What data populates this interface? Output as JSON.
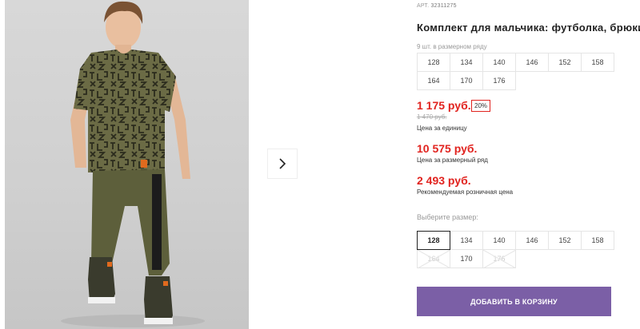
{
  "product": {
    "article_label": "АРТ.",
    "article_value": "32311275",
    "title": "Комплект для мальчика: футболка, брюки"
  },
  "pack": {
    "note": "9 шт. в размерном ряду",
    "sizes": [
      "128",
      "134",
      "140",
      "146",
      "152",
      "158",
      "164",
      "170",
      "176"
    ]
  },
  "prices": {
    "unit_price": "1 175 руб.",
    "discount": "20%",
    "old_price": "1 470 руб.",
    "unit_note": "Цена за единицу",
    "set_price": "10 575 руб.",
    "set_note": "Цена за размерный ряд",
    "rrp_price": "2 493 руб.",
    "rrp_note": "Рекомендуемая розничная цена"
  },
  "size_picker": {
    "label": "Выберите размер:",
    "selected": "128",
    "options": [
      {
        "label": "128",
        "state": "selected"
      },
      {
        "label": "134",
        "state": "available"
      },
      {
        "label": "140",
        "state": "available"
      },
      {
        "label": "146",
        "state": "available"
      },
      {
        "label": "152",
        "state": "available"
      },
      {
        "label": "158",
        "state": "available"
      },
      {
        "label": "164",
        "state": "unavailable"
      },
      {
        "label": "170",
        "state": "available"
      },
      {
        "label": "176",
        "state": "unavailable"
      }
    ]
  },
  "cart": {
    "button_label": "ДОБАВИТЬ В КОРЗИНУ"
  },
  "gallery": {
    "next_icon": "chevron-right-icon"
  },
  "colors": {
    "price_red": "#e1231f",
    "cart_purple": "#7b5fa6",
    "tshirt_khaki": "#6b6b45",
    "trousers_khaki": "#5d5f3b"
  }
}
